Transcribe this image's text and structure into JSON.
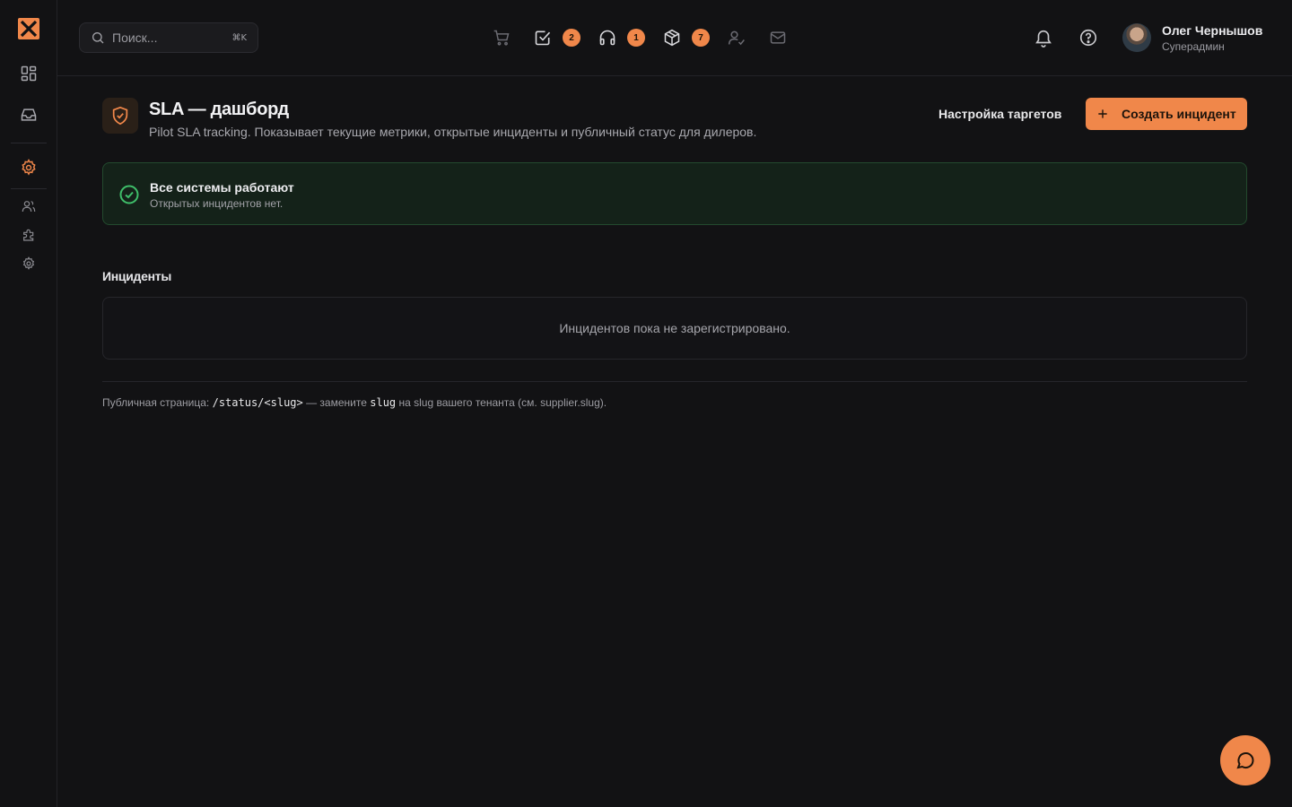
{
  "colors": {
    "accent": "#f0874a",
    "background": "#121214",
    "success": "#3fbf6a",
    "success_bg": "#142219"
  },
  "sidebar": {
    "logo_icon": "app-logo-icon",
    "items": [
      {
        "icon": "dashboard-grid-icon",
        "active": false
      },
      {
        "icon": "inbox-icon",
        "active": false
      },
      {
        "icon": "settings-gear-icon",
        "active": true
      },
      {
        "icon": "users-icon",
        "active": false
      },
      {
        "icon": "puzzle-icon",
        "active": false
      },
      {
        "icon": "cog-icon",
        "active": false
      }
    ]
  },
  "header": {
    "search": {
      "placeholder": "Поиск...",
      "shortcut": "⌘K"
    },
    "tools": [
      {
        "icon": "cart-icon",
        "badge": null
      },
      {
        "icon": "checkbox-icon",
        "badge": "2"
      },
      {
        "icon": "headphones-icon",
        "badge": "1"
      },
      {
        "icon": "package-icon",
        "badge": "7"
      },
      {
        "icon": "user-check-icon",
        "badge": null
      },
      {
        "icon": "mail-icon",
        "badge": null
      }
    ],
    "notifications_icon": "bell-icon",
    "help_icon": "help-circle-icon",
    "user": {
      "name": "Олег Чернышов",
      "role": "Суперадмин"
    }
  },
  "page": {
    "title": "SLA — дашборд",
    "subtitle": "Pilot SLA tracking. Показывает текущие метрики, открытые инциденты и публичный статус для дилеров.",
    "configure_targets_label": "Настройка таргетов",
    "create_incident_label": "Создать инцидент"
  },
  "status": {
    "title": "Все системы работают",
    "subtitle": "Открытых инцидентов нет."
  },
  "incidents": {
    "section_title": "Инциденты",
    "empty_text": "Инцидентов пока не зарегистрировано."
  },
  "footer": {
    "prefix": "Публичная страница:",
    "path": "/status/<slug>",
    "middle": "— замените",
    "slug_word": "slug",
    "suffix": "на slug вашего тенанта (см. supplier.slug)."
  },
  "chat_icon": "chat-bubble-icon"
}
